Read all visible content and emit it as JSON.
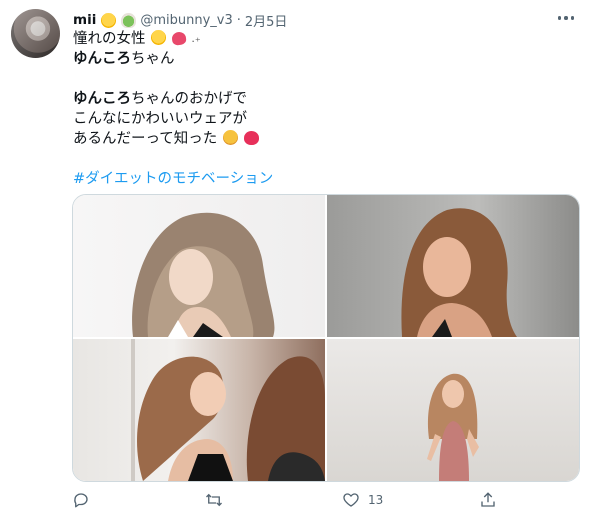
{
  "tweet": {
    "display_name": "mii",
    "handle": "@mibunny_v3",
    "separator": "·",
    "date": "2月5日",
    "lines": {
      "l1": "憧れの女性",
      "l2_bold": "ゆんころ",
      "l2_rest": "ちゃん",
      "l3_bold": "ゆんころ",
      "l3_rest": "ちゃんのおかげで",
      "l4": "こんなにかわいいウェアが",
      "l5": "あるんだーって知った",
      "hashtag": "#ダイエットのモチベーション"
    },
    "emoji": {
      "name_1": "chick-emoji",
      "name_2": "salad-emoji",
      "line1_1": "chick-emoji",
      "line1_2": "heart-emoji",
      "line1_3": "sparkle-emoji",
      "line5_1": "hugging-face-emoji",
      "line5_2": "heart-emoji"
    }
  },
  "actions": {
    "reply_icon": "reply-icon",
    "retweet_icon": "retweet-icon",
    "like_icon": "heart-icon",
    "like_count": "13",
    "share_icon": "share-icon"
  },
  "colors": {
    "text": "#0f1419",
    "secondary": "#536471",
    "accent": "#1d9bf0",
    "border": "#cfd9de"
  }
}
